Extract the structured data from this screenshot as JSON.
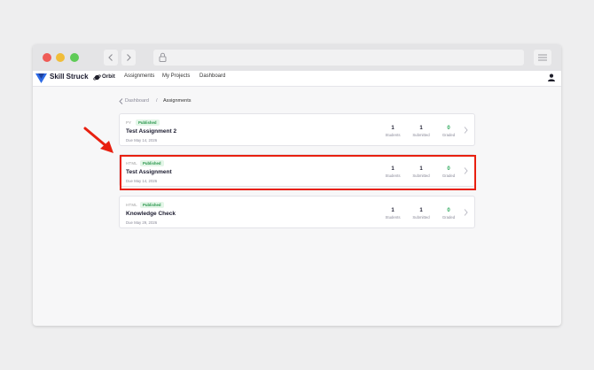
{
  "browser": {
    "back_icon": "chevron-left-icon",
    "forward_icon": "chevron-right-icon",
    "lock_icon": "lock-icon",
    "menu_icon": "hamburger-menu-icon"
  },
  "nav": {
    "brand": "Skill Struck",
    "product": "Orbit",
    "links": [
      "Assignments",
      "My Projects",
      "Dashboard"
    ],
    "user_icon": "user-icon"
  },
  "breadcrumb": {
    "parent": "Dashboard",
    "separator": "/",
    "current": "Assignments"
  },
  "assignments": [
    {
      "lang": "PY",
      "status": "Published",
      "title": "Test Assignment 2",
      "due": "Due May 14, 2026",
      "stats": [
        {
          "value": "1",
          "label": "Students"
        },
        {
          "value": "1",
          "label": "Submitted"
        },
        {
          "value": "0",
          "label": "Graded"
        }
      ]
    },
    {
      "lang": "HTML",
      "status": "Published",
      "title": "Test Assignment",
      "due": "Due May 14, 2026",
      "stats": [
        {
          "value": "1",
          "label": "Students"
        },
        {
          "value": "1",
          "label": "Submitted"
        },
        {
          "value": "0",
          "label": "Graded"
        }
      ]
    },
    {
      "lang": "HTML",
      "status": "Published",
      "title": "Knowledge Check",
      "due": "Due May 29, 2026",
      "stats": [
        {
          "value": "1",
          "label": "Students"
        },
        {
          "value": "1",
          "label": "Submitted"
        },
        {
          "value": "0",
          "label": "Graded"
        }
      ]
    }
  ],
  "colors": {
    "highlight": "#e82010",
    "published_badge": "#27954a",
    "graded": "#2aa85a"
  }
}
